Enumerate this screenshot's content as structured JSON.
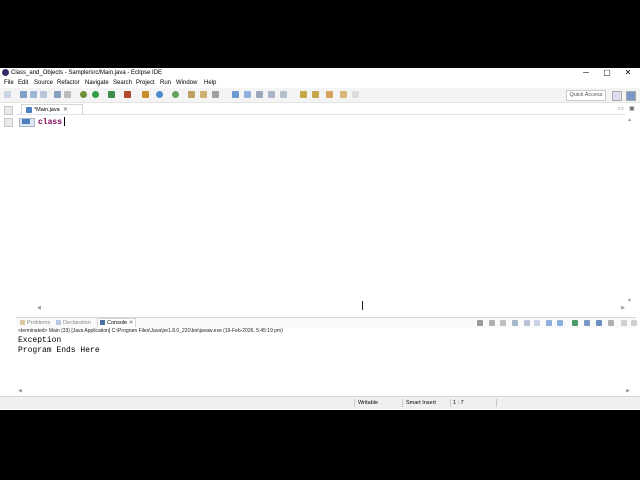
{
  "window": {
    "title": "Class_and_Objects - Sample/src/Main.java - Eclipse IDE",
    "controls": [
      "─",
      "▢",
      "✕"
    ]
  },
  "menu": [
    "File",
    "Edit",
    "Source",
    "Refactor",
    "Navigate",
    "Search",
    "Project",
    "Run",
    "Window",
    "Help"
  ],
  "toolbar": {
    "quick_access": "Quick Access"
  },
  "editor": {
    "tab_label": "*Main.java",
    "tab_close": "✕",
    "code_line": "class"
  },
  "bottom_panel": {
    "tabs": [
      "Problems",
      "Declaration",
      "Console"
    ],
    "active_tab": "Console",
    "tab_close": "✕",
    "terminated": "<terminated> Main (33) [Java Application] C:\\Program Files\\Java\\jre1.8.0_231\\bin\\javaw.exe (19-Feb-2026, 5:45:19 pm)",
    "output": [
      "Exception",
      "Program Ends Here"
    ]
  },
  "status": {
    "writable": "Writable",
    "insert_mode": "Smart Insert",
    "position": "1 : 7"
  },
  "colors": {
    "keyword": "#7f0055",
    "accent": "#4b7fc2"
  }
}
